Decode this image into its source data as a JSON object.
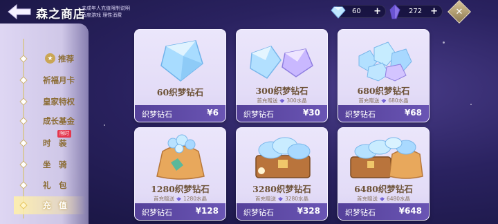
{
  "header": {
    "title": "森之商店",
    "notice_line1": "未成年人充值限制说明",
    "notice_line2": "适度游戏 理性消费",
    "currencies": [
      {
        "icon": "diamond-icon",
        "amount": "60",
        "plus": "+"
      },
      {
        "icon": "crystal-icon",
        "amount": "272",
        "plus": "+"
      }
    ],
    "close_glyph": "✕"
  },
  "sidebar": {
    "items": [
      {
        "label": "推荐",
        "badge": "★"
      },
      {
        "label": "祈福月卡"
      },
      {
        "label": "皇家特权"
      },
      {
        "label": "成长基金"
      },
      {
        "label": "时　装",
        "tag": "限时"
      },
      {
        "label": "坐　骑"
      },
      {
        "label": "礼　包"
      },
      {
        "label": "充　值",
        "active": true
      }
    ]
  },
  "products": [
    {
      "name": "60织梦钻石",
      "bonus": "",
      "currency_name": "织梦钻石",
      "price": "¥6"
    },
    {
      "name": "300织梦钻石",
      "bonus_label": "首充赠送",
      "bonus_value": "300水晶",
      "currency_name": "织梦钻石",
      "price": "¥30"
    },
    {
      "name": "680织梦钻石",
      "bonus_label": "首充赠送",
      "bonus_value": "680水晶",
      "currency_name": "织梦钻石",
      "price": "¥68"
    },
    {
      "name": "1280织梦钻石",
      "bonus_label": "首充赠送",
      "bonus_value": "1280水晶",
      "currency_name": "织梦钻石",
      "price": "¥128"
    },
    {
      "name": "3280织梦钻石",
      "bonus_label": "首充赠送",
      "bonus_value": "3280水晶",
      "currency_name": "织梦钻石",
      "price": "¥328"
    },
    {
      "name": "6480织梦钻石",
      "bonus_label": "首充赠送",
      "bonus_value": "6480水晶",
      "currency_name": "织梦钻石",
      "price": "¥648"
    }
  ]
}
